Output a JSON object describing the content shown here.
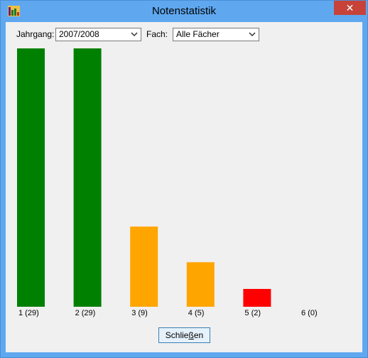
{
  "window": {
    "title": "Notenstatistik",
    "close_glyph": "✕"
  },
  "filters": {
    "year_label": "Jahrgang:",
    "year_value": "2007/2008",
    "subject_label": "Fach:",
    "subject_value": "Alle Fächer"
  },
  "chart_data": {
    "type": "bar",
    "categories": [
      "1 (29)",
      "2 (29)",
      "3 (9)",
      "4 (5)",
      "5 (2)",
      "6 (0)"
    ],
    "values": [
      29,
      29,
      9,
      5,
      2,
      0
    ],
    "colors": [
      "#008000",
      "#008000",
      "#ffa500",
      "#ffa500",
      "#ff0000",
      "#ff0000"
    ],
    "ylim": [
      0,
      29
    ]
  },
  "footer": {
    "close_label": "Schließen",
    "accesskey": "ß"
  }
}
